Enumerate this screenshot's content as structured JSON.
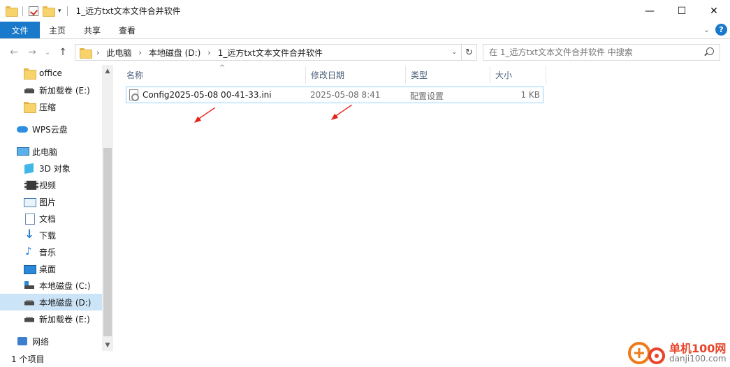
{
  "window": {
    "title": "1_远方txt文本文件合并软件",
    "minimize_glyph": "—",
    "maximize_glyph": "☐",
    "close_glyph": "✕"
  },
  "quick_access": {
    "dropdown_glyph": "▾"
  },
  "ribbon": {
    "tabs": [
      "文件",
      "主页",
      "共享",
      "查看"
    ],
    "expand_glyph": "⌄",
    "help_glyph": "?"
  },
  "nav": {
    "back_glyph": "←",
    "forward_glyph": "→",
    "recent_glyph": "⌄",
    "up_glyph": "↑"
  },
  "address": {
    "crumbs": [
      "此电脑",
      "本地磁盘 (D:)",
      "1_远方txt文本文件合并软件"
    ],
    "separator_glyph": "›",
    "dropdown_glyph": "⌄",
    "refresh_glyph": "↻"
  },
  "search": {
    "placeholder": "在 1_远方txt文本文件合并软件 中搜索"
  },
  "sidebar": {
    "items": [
      {
        "label": "office",
        "icon": "folder-icon"
      },
      {
        "label": "新加载卷 (E:)",
        "icon": "drive-icon"
      },
      {
        "label": "压缩",
        "icon": "folder-icon"
      },
      {
        "label": "WPS云盘",
        "icon": "cloud-icon"
      },
      {
        "label": "此电脑",
        "icon": "computer-icon"
      },
      {
        "label": "3D 对象",
        "icon": "3d-objects-icon"
      },
      {
        "label": "视频",
        "icon": "video-icon"
      },
      {
        "label": "图片",
        "icon": "pictures-icon"
      },
      {
        "label": "文档",
        "icon": "documents-icon"
      },
      {
        "label": "下载",
        "icon": "download-icon"
      },
      {
        "label": "音乐",
        "icon": "music-icon"
      },
      {
        "label": "桌面",
        "icon": "desktop-icon"
      },
      {
        "label": "本地磁盘 (C:)",
        "icon": "system-drive-icon"
      },
      {
        "label": "本地磁盘 (D:)",
        "icon": "drive-icon"
      },
      {
        "label": "新加载卷 (E:)",
        "icon": "drive-icon"
      },
      {
        "label": "网络",
        "icon": "network-icon"
      }
    ],
    "scroll_up_glyph": "▲",
    "scroll_down_glyph": "▼"
  },
  "filelist": {
    "columns": [
      "名称",
      "修改日期",
      "类型",
      "大小"
    ],
    "sort_glyph": "^",
    "rows": [
      {
        "name": "Config2025-05-08 00-41-33.ini",
        "modified": "2025-05-08 8:41",
        "type": "配置设置",
        "size": "1 KB"
      }
    ]
  },
  "status": {
    "item_count": "1 个项目"
  },
  "watermark": {
    "brand": "单机100网",
    "domain": "danji100.com"
  },
  "colors": {
    "accent": "#1979ca",
    "selection": "#cce4f7",
    "row_border": "#99d1ff",
    "annotation_arrow": "#e8201a"
  }
}
